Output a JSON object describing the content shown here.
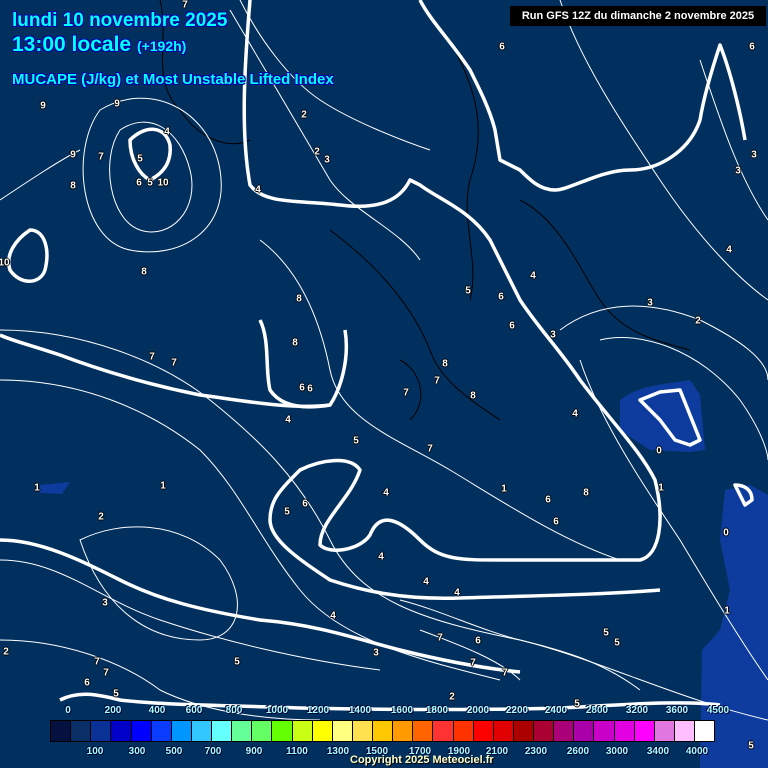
{
  "header": {
    "date": "lundi 10 novembre 2025",
    "time": "13:00 locale",
    "lead": "(+192h)",
    "parameter": "MUCAPE (J/kg) et Most Unstable Lifted Index",
    "run": "Run GFS 12Z du dimanche 2 novembre 2025"
  },
  "legend": {
    "colors": [
      "#05123f",
      "#0a2f66",
      "#0a3296",
      "#0000c8",
      "#0000ff",
      "#0a3cff",
      "#0096ff",
      "#32c8ff",
      "#64ffff",
      "#64ff96",
      "#64ff64",
      "#64ff00",
      "#c8ff14",
      "#ffff00",
      "#ffff80",
      "#ffe150",
      "#ffc800",
      "#ff9b00",
      "#ff6400",
      "#ff3232",
      "#ff3200",
      "#ff0000",
      "#e00000",
      "#aa0000",
      "#aa0032",
      "#aa0078",
      "#aa00aa",
      "#c800c8",
      "#e100e1",
      "#ff00ff",
      "#e178e1",
      "#ffbeff",
      "#ffffff"
    ],
    "top_ticks": [
      "0",
      "200",
      "400",
      "600",
      "800",
      "1000",
      "1200",
      "1400",
      "1600",
      "1800",
      "2000",
      "2200",
      "2400",
      "2800",
      "3200",
      "3600",
      "4500"
    ],
    "bottom_ticks": [
      "100",
      "300",
      "500",
      "700",
      "900",
      "1100",
      "1300",
      "1500",
      "1700",
      "1900",
      "2100",
      "2300",
      "2600",
      "3000",
      "3400",
      "4000"
    ]
  },
  "contour_labels": [
    "7",
    "6",
    "6",
    "9",
    "9",
    "2",
    "4",
    "9",
    "7",
    "5",
    "2",
    "3",
    "3",
    "3",
    "8",
    "6",
    "5",
    "10",
    "4",
    "4",
    "10",
    "8",
    "4",
    "5",
    "6",
    "3",
    "8",
    "2",
    "6",
    "3",
    "8",
    "7",
    "7",
    "8",
    "7",
    "6",
    "6",
    "7",
    "8",
    "4",
    "4",
    "5",
    "7",
    "0",
    "1",
    "1",
    "4",
    "1",
    "6",
    "8",
    "1",
    "6",
    "5",
    "2",
    "6",
    "0",
    "4",
    "4",
    "4",
    "3",
    "4",
    "1",
    "5",
    "5",
    "7",
    "6",
    "2",
    "7",
    "5",
    "3",
    "7",
    "7",
    "7",
    "6",
    "5",
    "2",
    "5",
    "5"
  ],
  "copyright": "Copyright 2025 Meteociel.fr"
}
